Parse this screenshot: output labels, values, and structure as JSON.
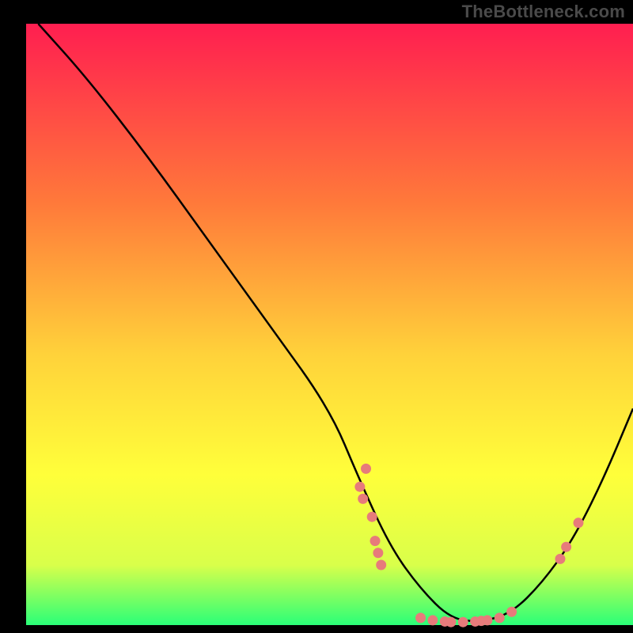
{
  "watermark": "TheBottleneck.com",
  "chart_data": {
    "type": "line",
    "title": "",
    "xlabel": "",
    "ylabel": "",
    "xlim": [
      0,
      100
    ],
    "ylim": [
      0,
      100
    ],
    "grid": false,
    "legend": false,
    "series": [
      {
        "name": "curve",
        "x": [
          2,
          10,
          20,
          30,
          40,
          50,
          55,
          60,
          65,
          70,
          75,
          80,
          85,
          90,
          95,
          100
        ],
        "y": [
          100,
          91,
          78,
          64,
          50,
          36,
          24,
          13,
          6,
          1,
          0.5,
          2,
          7,
          14,
          24,
          36
        ]
      }
    ],
    "scatter_points": [
      {
        "x": 55,
        "y": 23
      },
      {
        "x": 55.5,
        "y": 21
      },
      {
        "x": 56,
        "y": 26
      },
      {
        "x": 57,
        "y": 18
      },
      {
        "x": 57.5,
        "y": 14
      },
      {
        "x": 58,
        "y": 12
      },
      {
        "x": 58.5,
        "y": 10
      },
      {
        "x": 65,
        "y": 1.2
      },
      {
        "x": 67,
        "y": 0.8
      },
      {
        "x": 69,
        "y": 0.6
      },
      {
        "x": 70,
        "y": 0.5
      },
      {
        "x": 72,
        "y": 0.5
      },
      {
        "x": 74,
        "y": 0.6
      },
      {
        "x": 75,
        "y": 0.7
      },
      {
        "x": 76,
        "y": 0.8
      },
      {
        "x": 78,
        "y": 1.2
      },
      {
        "x": 80,
        "y": 2.2
      },
      {
        "x": 88,
        "y": 11
      },
      {
        "x": 89,
        "y": 13
      },
      {
        "x": 91,
        "y": 17
      }
    ],
    "background_gradient": {
      "top": "#ff1e50",
      "mid1": "#ff7a3a",
      "mid2": "#ffd23a",
      "mid3": "#ffff3a",
      "lower": "#d9ff4a",
      "bottom": "#2aff78"
    },
    "curve_color": "#000000",
    "point_color": "#e77b7b"
  }
}
